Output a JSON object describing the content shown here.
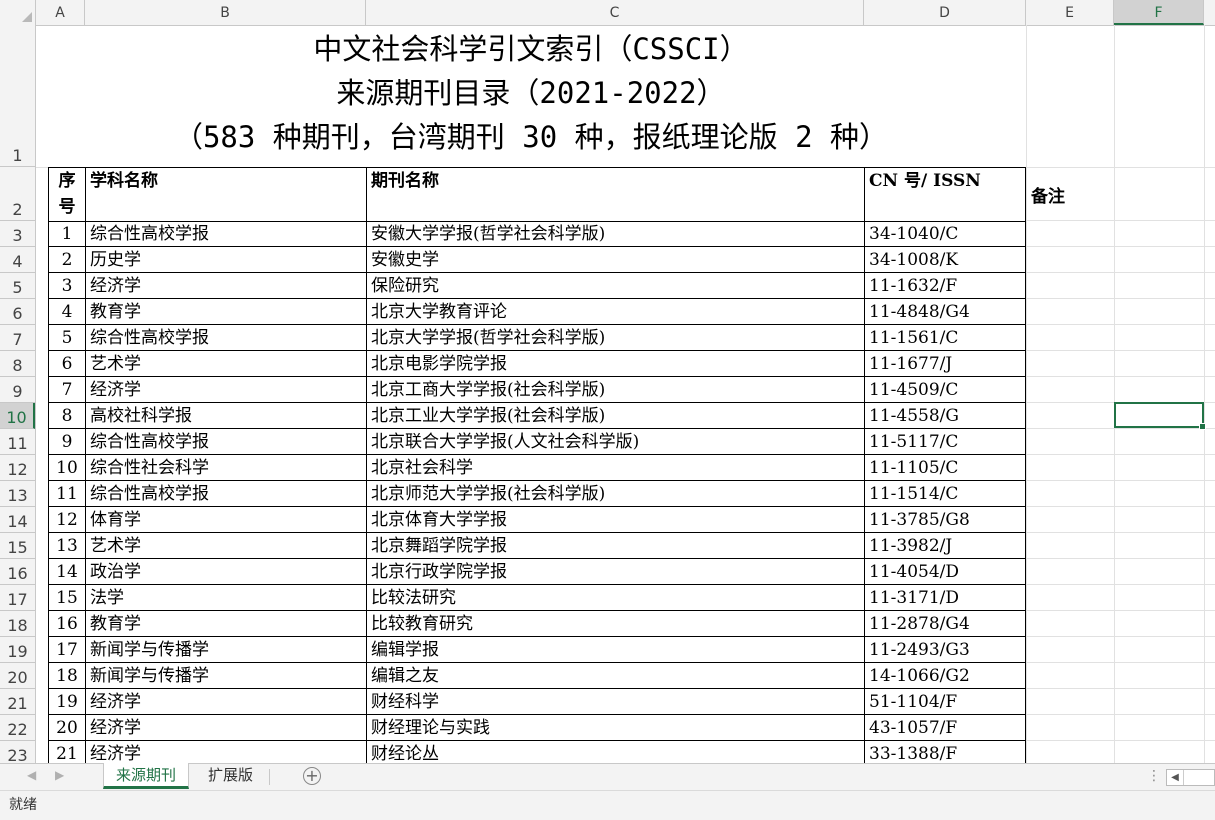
{
  "columns": [
    "A",
    "B",
    "C",
    "D",
    "E",
    "F"
  ],
  "active_column": "F",
  "row_numbers": [
    "1",
    "2",
    "3",
    "4",
    "5",
    "6",
    "7",
    "8",
    "9",
    "10",
    "11",
    "12",
    "13",
    "14",
    "15",
    "16",
    "17",
    "18",
    "19",
    "20",
    "21",
    "22",
    "23"
  ],
  "active_row": "10",
  "title": {
    "line1": "中文社会科学引文索引（CSSCI）",
    "line2": "来源期刊目录（2021-2022）",
    "line3": "（583 种期刊，台湾期刊 30 种，报纸理论版 2 种）"
  },
  "table": {
    "headers": {
      "seq": "序号",
      "subject": "学科名称",
      "journal": "期刊名称",
      "cn": "CN 号/ ISSN",
      "remark": "备注"
    },
    "rows": [
      {
        "seq": "1",
        "subject": "综合性高校学报",
        "journal": "安徽大学学报(哲学社会科学版)",
        "cn": "34-1040/C"
      },
      {
        "seq": "2",
        "subject": "历史学",
        "journal": "安徽史学",
        "cn": "34-1008/K"
      },
      {
        "seq": "3",
        "subject": "经济学",
        "journal": "保险研究",
        "cn": "11-1632/F"
      },
      {
        "seq": "4",
        "subject": "教育学",
        "journal": "北京大学教育评论",
        "cn": "11-4848/G4"
      },
      {
        "seq": "5",
        "subject": "综合性高校学报",
        "journal": "北京大学学报(哲学社会科学版)",
        "cn": "11-1561/C"
      },
      {
        "seq": "6",
        "subject": "艺术学",
        "journal": "北京电影学院学报",
        "cn": "11-1677/J"
      },
      {
        "seq": "7",
        "subject": "经济学",
        "journal": "北京工商大学学报(社会科学版)",
        "cn": "11-4509/C"
      },
      {
        "seq": "8",
        "subject": "高校社科学报",
        "journal": "北京工业大学学报(社会科学版)",
        "cn": "11-4558/G"
      },
      {
        "seq": "9",
        "subject": "综合性高校学报",
        "journal": "北京联合大学学报(人文社会科学版)",
        "cn": "11-5117/C"
      },
      {
        "seq": "10",
        "subject": "综合性社会科学",
        "journal": "北京社会科学",
        "cn": "11-1105/C"
      },
      {
        "seq": "11",
        "subject": "综合性高校学报",
        "journal": "北京师范大学学报(社会科学版)",
        "cn": "11-1514/C"
      },
      {
        "seq": "12",
        "subject": "体育学",
        "journal": "北京体育大学学报",
        "cn": "11-3785/G8"
      },
      {
        "seq": "13",
        "subject": "艺术学",
        "journal": "北京舞蹈学院学报",
        "cn": "11-3982/J"
      },
      {
        "seq": "14",
        "subject": "政治学",
        "journal": "北京行政学院学报",
        "cn": "11-4054/D"
      },
      {
        "seq": "15",
        "subject": "法学",
        "journal": "比较法研究",
        "cn": "11-3171/D"
      },
      {
        "seq": "16",
        "subject": "教育学",
        "journal": "比较教育研究",
        "cn": "11-2878/G4"
      },
      {
        "seq": "17",
        "subject": "新闻学与传播学",
        "journal": "编辑学报",
        "cn": "11-2493/G3"
      },
      {
        "seq": "18",
        "subject": "新闻学与传播学",
        "journal": "编辑之友",
        "cn": "14-1066/G2"
      },
      {
        "seq": "19",
        "subject": "经济学",
        "journal": "财经科学",
        "cn": "51-1104/F"
      },
      {
        "seq": "20",
        "subject": "经济学",
        "journal": "财经理论与实践",
        "cn": "43-1057/F"
      },
      {
        "seq": "21",
        "subject": "经济学",
        "journal": "财经论丛",
        "cn": "33-1388/F"
      }
    ]
  },
  "sheet_tabs": [
    {
      "label": "来源期刊",
      "active": true
    },
    {
      "label": "扩展版",
      "active": false
    }
  ],
  "add_sheet_symbol": "+",
  "status": "就绪",
  "icons": [
    "corner-select-all-icon",
    "prev-sheet-icon",
    "next-sheet-icon",
    "add-sheet-icon",
    "more-options-icon",
    "scroll-left-icon"
  ]
}
